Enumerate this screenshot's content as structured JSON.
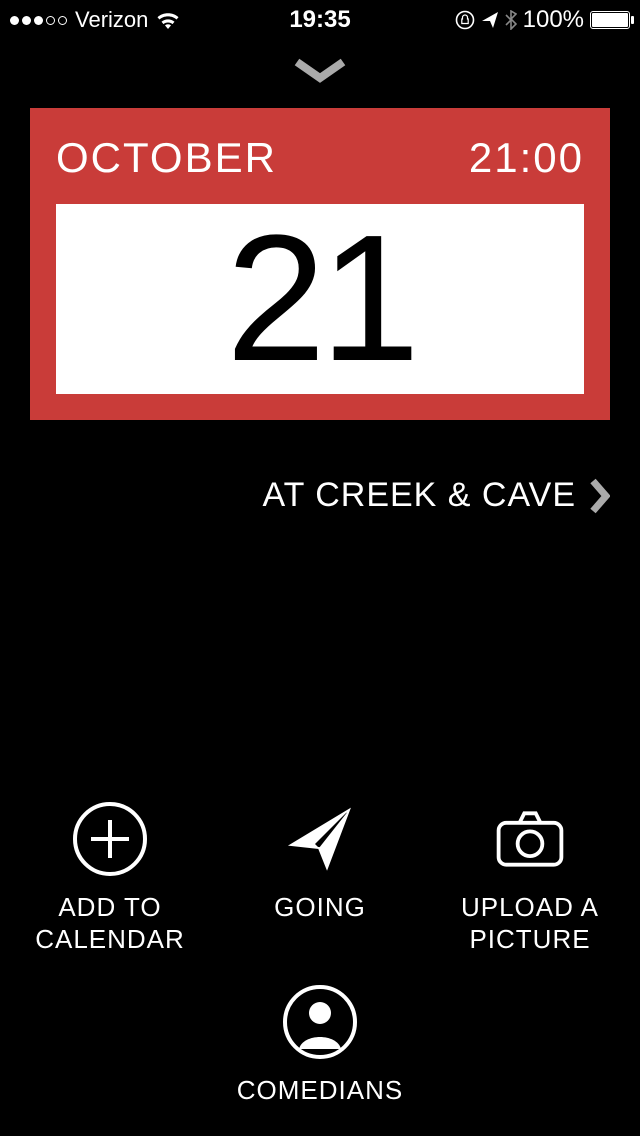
{
  "status": {
    "carrier": "Verizon",
    "time": "19:35",
    "battery_pct": "100%"
  },
  "event": {
    "month": "OCTOBER",
    "start_time": "21:00",
    "day": "21",
    "venue_label": "AT CREEK & CAVE"
  },
  "actions": {
    "add_calendar": "ADD TO\nCALENDAR",
    "going": "GOING",
    "upload_picture": "UPLOAD A\nPICTURE",
    "comedians": "COMEDIANS"
  }
}
